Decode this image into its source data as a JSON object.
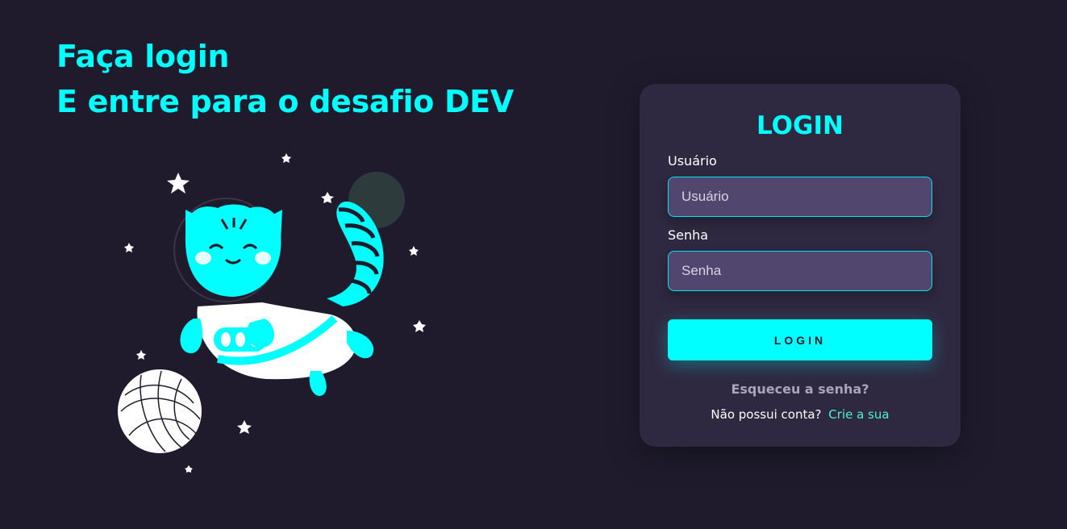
{
  "hero": {
    "line1": "Faça login",
    "line2": "E entre para o desafio DEV"
  },
  "illustration": {
    "subject": "astronaut-cat-with-yarn-ball"
  },
  "login_card": {
    "title": "LOGIN",
    "username": {
      "label": "Usuário",
      "placeholder": "Usuário",
      "value": ""
    },
    "password": {
      "label": "Senha",
      "placeholder": "Senha",
      "value": ""
    },
    "submit_label": "LOGIN",
    "forgot_password": "Esqueceu a senha?",
    "signup_prompt": "Não possui conta?",
    "signup_link": "Crie a sua"
  },
  "colors": {
    "background": "#1f1b2d",
    "card": "#2e2840",
    "accent": "#00ffff",
    "input_bg": "#51466d",
    "link": "#4ff0d8"
  }
}
